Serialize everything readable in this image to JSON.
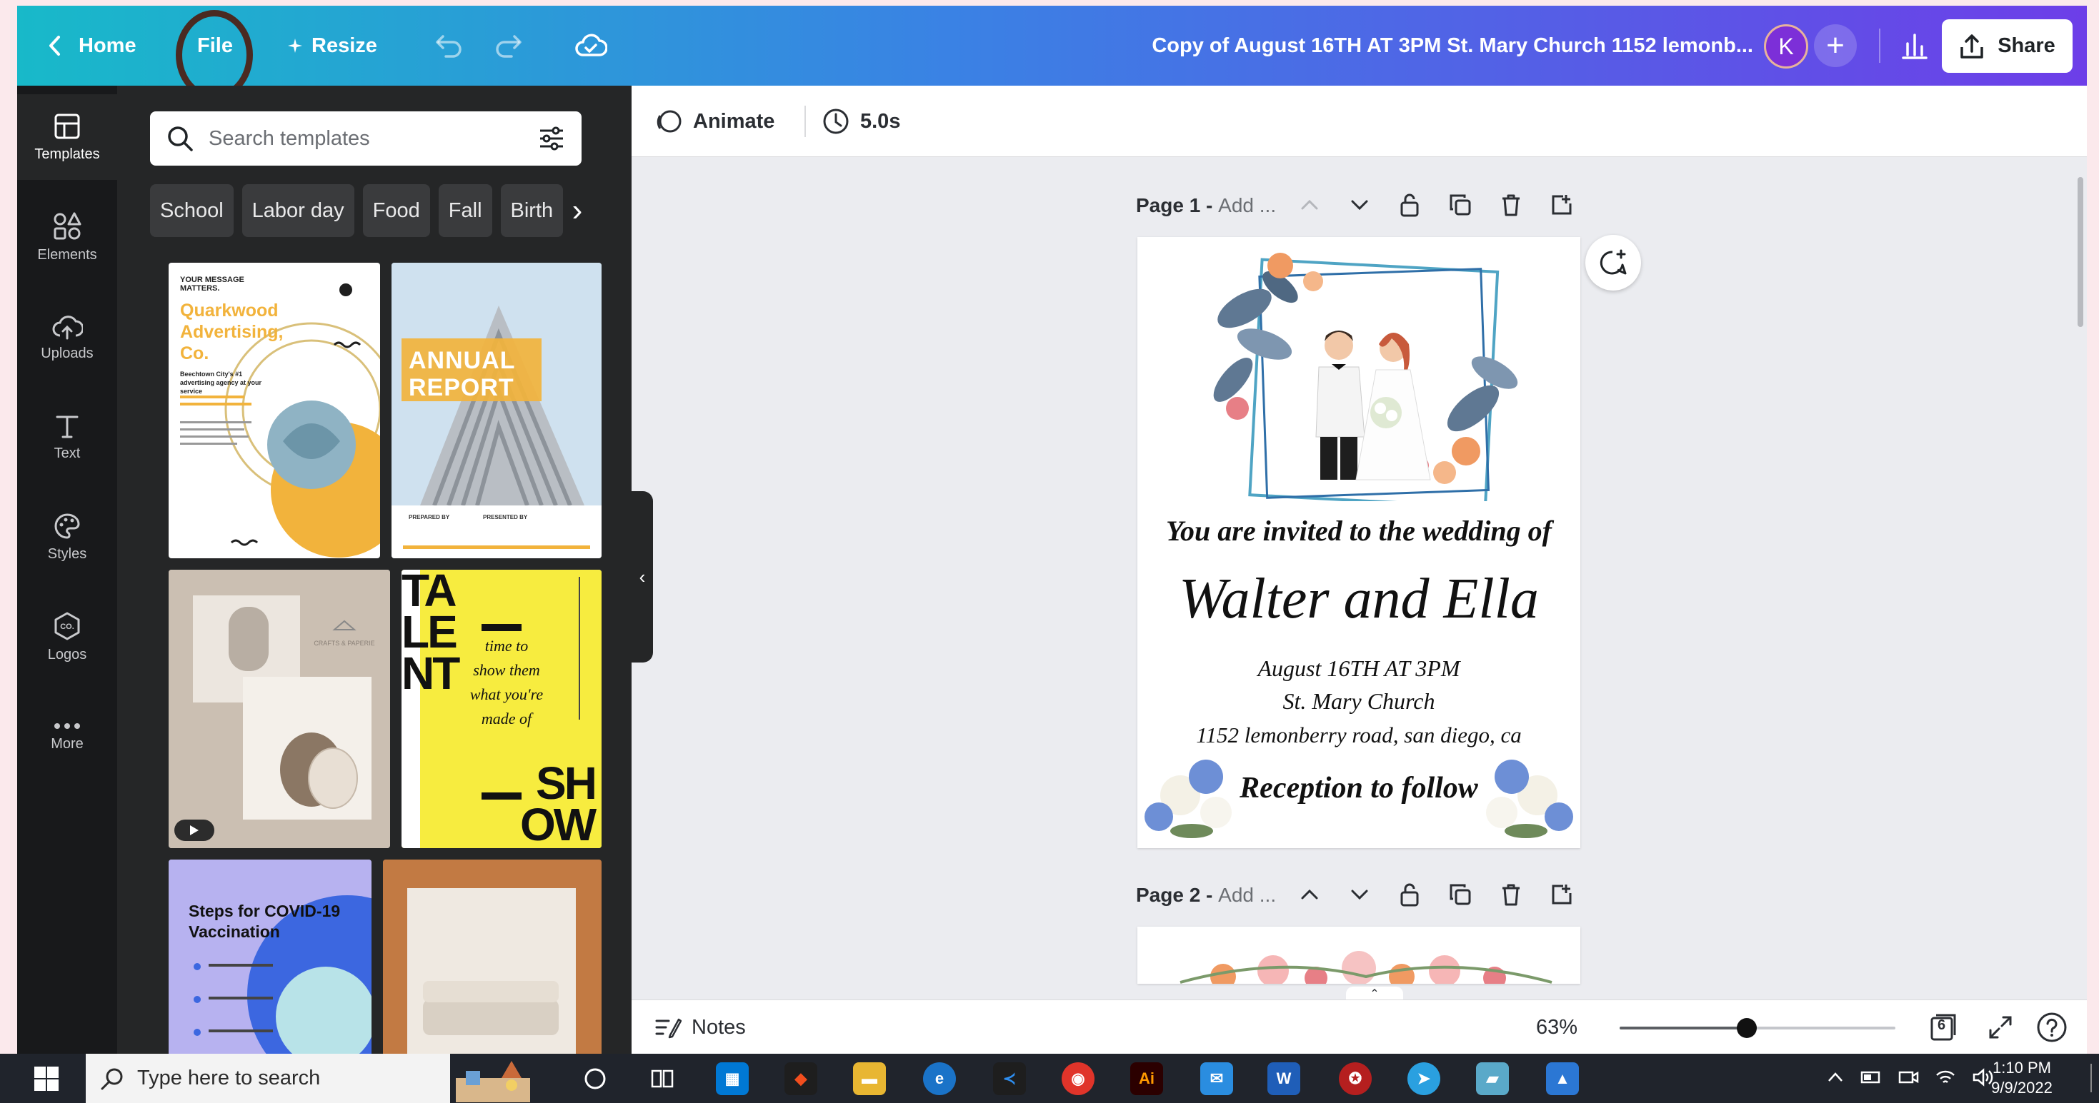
{
  "topbar": {
    "home_label": "Home",
    "file_label": "File",
    "resize_label": "Resize",
    "doc_title": "Copy of August 16TH AT 3PM St. Mary Church 1152 lemonb...",
    "avatar_initial": "K",
    "share_label": "Share"
  },
  "rail": {
    "items": [
      {
        "label": "Templates",
        "icon": "templates-icon"
      },
      {
        "label": "Elements",
        "icon": "elements-icon"
      },
      {
        "label": "Uploads",
        "icon": "uploads-icon"
      },
      {
        "label": "Text",
        "icon": "text-icon"
      },
      {
        "label": "Styles",
        "icon": "styles-icon"
      },
      {
        "label": "Logos",
        "icon": "logos-icon"
      },
      {
        "label": "More",
        "icon": "more-icon"
      }
    ]
  },
  "panel": {
    "search_placeholder": "Search templates",
    "chips": [
      "School",
      "Labor day",
      "Food",
      "Fall",
      "Birth"
    ],
    "thumbs": {
      "t1": {
        "kicker": "YOUR MESSAGE MATTERS.",
        "headline": "Quarkwood Advertising, Co.",
        "sub": "Beechtown City's #1 advertising agency at your service"
      },
      "t2": {
        "headline1": "ANNUAL",
        "headline2": "REPORT",
        "prepared": "PREPARED BY",
        "presented": "PRESENTED BY"
      },
      "t3": {
        "brand": "CRAFTS & PAPERIE"
      },
      "t4": {
        "big1": "TA",
        "big2": "LE",
        "big3": "NT",
        "body": "time to show them what you're made of",
        "big4": "SH",
        "big5": "OW"
      },
      "t5": {
        "headline": "Steps for COVID-19 Vaccination"
      }
    }
  },
  "editor": {
    "animate_label": "Animate",
    "duration_label": "5.0s",
    "page1_label": "Page 1 -",
    "page1_title_ph": "Add ...",
    "page2_label": "Page 2 -",
    "page2_title_ph": "Add ...",
    "invite": {
      "line1": "You are invited to the wedding of",
      "names": "Walter and Ella",
      "date": "August 16TH AT 3PM",
      "venue": "St. Mary Church",
      "address": "1152 lemonberry road, san diego, ca",
      "reception": "Reception to follow"
    }
  },
  "bottombar": {
    "notes_label": "Notes",
    "zoom_label": "63%",
    "zoom_fraction": 0.46,
    "pages_count": "6"
  },
  "taskbar": {
    "search_placeholder": "Type here to search",
    "time": "1:10 PM",
    "date": "9/9/2022"
  },
  "colors": {
    "topbar_start": "#18b9c9",
    "topbar_end": "#6d3ee8",
    "rail_bg": "#18191b",
    "panel_bg": "#252627",
    "canvas_bg": "#ebecf0",
    "annotation_circle": "#4a2a22"
  }
}
